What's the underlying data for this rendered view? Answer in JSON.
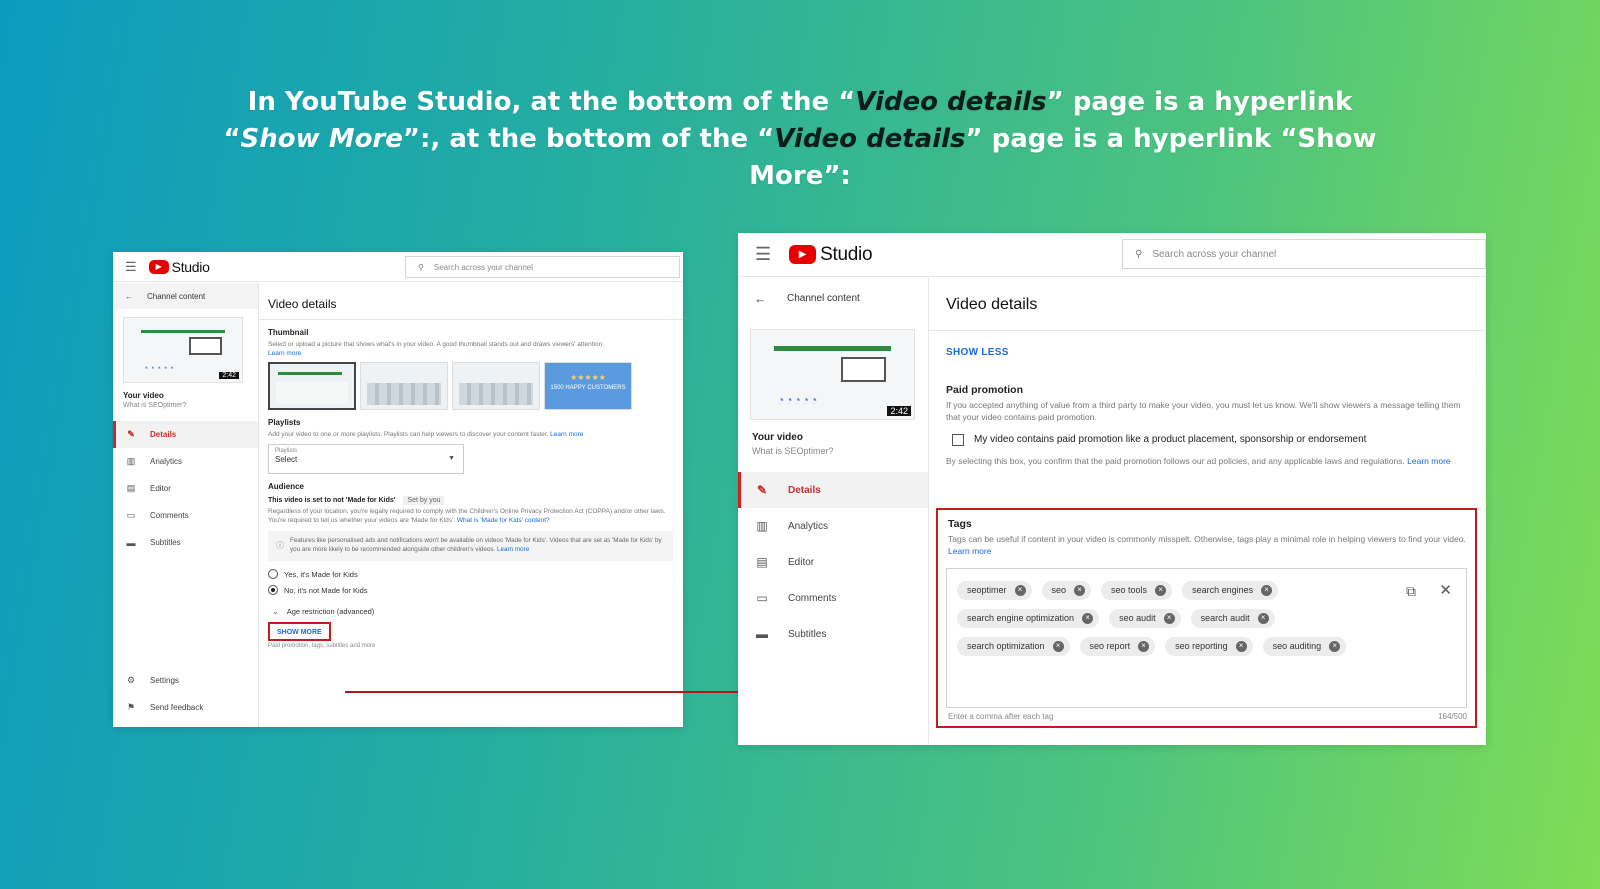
{
  "headline": {
    "p1": "In YouTube Studio, at the bottom of the “",
    "i1": "Video details",
    "p2": "” page is a hyperlink “",
    "i2": "Show More",
    "p3": "”:, at the bottom of the “",
    "i3": "Video details",
    "p4": "” page is a hyperlink “Show More”:"
  },
  "studio": {
    "logo_text": "Studio",
    "search_placeholder": "Search across your channel",
    "back_label": "Channel content",
    "thumb_duration": "2:42",
    "your_video": "Your video",
    "video_name": "What is SEOptimer?",
    "nav": [
      "Details",
      "Analytics",
      "Editor",
      "Comments",
      "Subtitles"
    ],
    "bottom_nav": [
      "Settings",
      "Send feedback"
    ],
    "page_title": "Video details"
  },
  "left": {
    "thumbnail": {
      "heading": "Thumbnail",
      "desc": "Select or upload a picture that shows what's in your video. A good thumbnail stands out and draws viewers' attention.",
      "learn_more": "Learn more",
      "star_card": "1500 HAPPY CUSTOMERS"
    },
    "playlists": {
      "heading": "Playlists",
      "desc": "Add your video to one or more playlists. Playlists can help viewers to discover your content faster.",
      "learn_more": "Learn more",
      "select_label": "Playlists",
      "select_value": "Select"
    },
    "audience": {
      "heading": "Audience",
      "status": "This video is set to not 'Made for Kids'",
      "set_by": "Set by you",
      "desc": "Regardless of your location, you're legally required to comply with the Children's Online Privacy Protection Act (COPPA) and/or other laws. You're required to tell us whether your videos are 'Made for Kids'.",
      "what_is": "What is 'Made for Kids' content?",
      "info": "Features like personalised ads and notifications won't be available on videos 'Made for Kids'. Videos that are set as 'Made for Kids' by you are more likely to be recommended alongside other children's videos.",
      "info_link": "Learn more",
      "opt_yes": "Yes, it's Made for Kids",
      "opt_no": "No, it's not Made for Kids"
    },
    "age_restriction": "Age restriction (advanced)",
    "show_more": "SHOW MORE",
    "show_more_sub": "Paid promotion, tags, subtitles and more"
  },
  "right": {
    "show_less": "SHOW LESS",
    "paid": {
      "heading": "Paid promotion",
      "desc": "If you accepted anything of value from a third party to make your video, you must let us know. We'll show viewers a message telling them that your video contains paid promotion.",
      "checkbox": "My video contains paid promotion like a product placement, sponsorship or endorsement",
      "confirm": "By selecting this box, you confirm that the paid promotion follows our ad policies, and any applicable laws and regulations.",
      "learn_more": "Learn more"
    },
    "tags": {
      "heading": "Tags",
      "desc": "Tags can be useful if content in your video is commonly misspelt. Otherwise, tags play a minimal role in helping viewers to find your video.",
      "learn_more": "Learn more",
      "chips": [
        "seoptimer",
        "seo",
        "seo tools",
        "search engines",
        "search engine optimization",
        "seo audit",
        "search audit",
        "search optimization",
        "seo report",
        "seo reporting",
        "seo auditing"
      ],
      "hint": "Enter a comma after each tag",
      "count": "164/500"
    }
  }
}
